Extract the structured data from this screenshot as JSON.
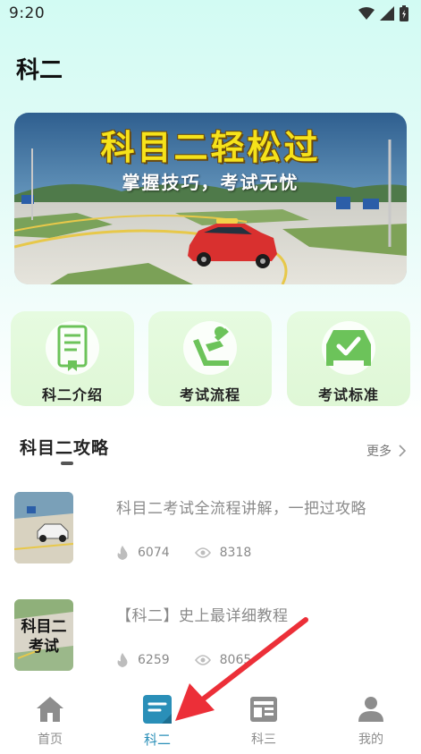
{
  "status_bar": {
    "time": "9:20"
  },
  "page_title": "科二",
  "banner": {
    "title": "科目二轻松过",
    "subtitle": "掌握技巧，考试无忧"
  },
  "quick_links": [
    {
      "label": "科二介绍",
      "icon": "certificate-icon"
    },
    {
      "label": "考试流程",
      "icon": "seat-icon"
    },
    {
      "label": "考试标准",
      "icon": "car-check-icon"
    }
  ],
  "section": {
    "title": "科目二攻略",
    "more": "更多"
  },
  "articles": [
    {
      "title": "科目二考试全流程讲解，一把过攻略",
      "likes": "6074",
      "views": "8318"
    },
    {
      "title": "【科二】史上最详细教程",
      "likes": "6259",
      "views": "8065",
      "thumb_text": "科目二考试"
    }
  ],
  "tabs": [
    {
      "label": "首页",
      "icon": "home-icon"
    },
    {
      "label": "科二",
      "icon": "note-icon",
      "active": true
    },
    {
      "label": "科三",
      "icon": "layout-icon"
    },
    {
      "label": "我的",
      "icon": "user-icon"
    }
  ],
  "colors": {
    "accent": "#2a8fb8",
    "card_bg": "#dff7d6",
    "icon_green": "#6cc35a",
    "arrow": "#ec2f38"
  }
}
